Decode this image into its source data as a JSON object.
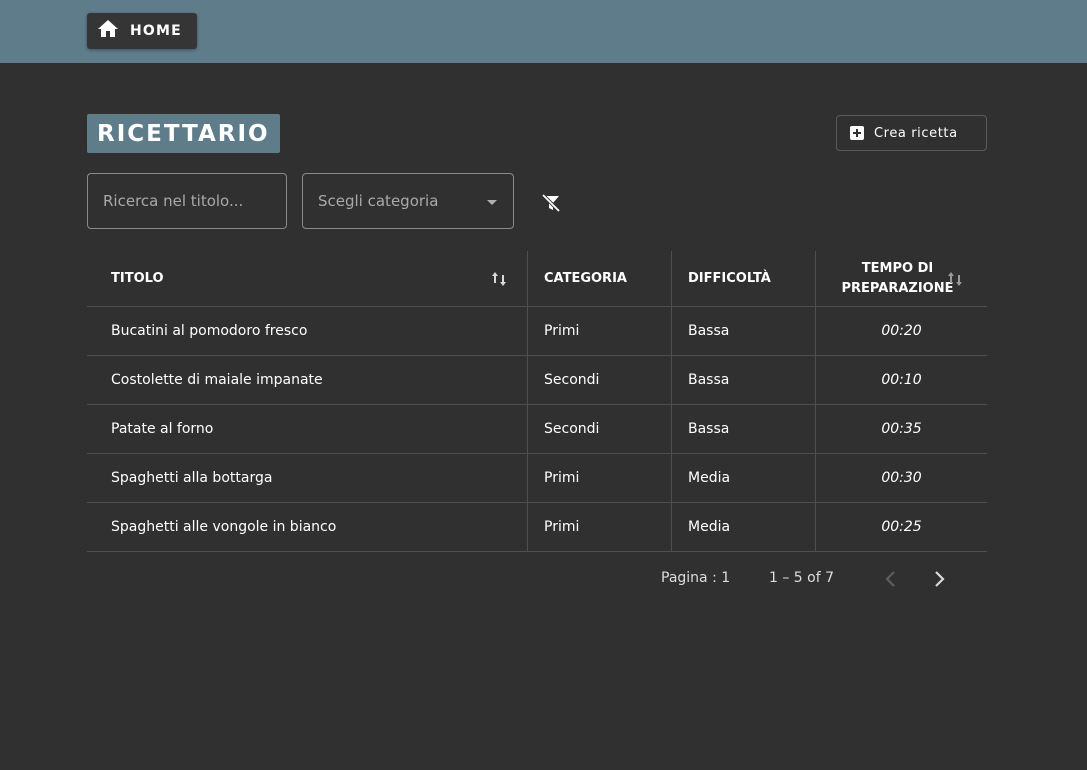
{
  "nav": {
    "home_label": "HOME"
  },
  "page": {
    "title": "RICETTARIO",
    "create_label": "Crea ricetta"
  },
  "filters": {
    "search_placeholder": "Ricerca nel titolo...",
    "category_placeholder": "Scegli categoria"
  },
  "table": {
    "headers": {
      "title": "TITOLO",
      "category": "CATEGORIA",
      "difficulty": "DIFFICOLTÀ",
      "prep_time": "TEMPO DI PREPARAZIONE"
    },
    "rows": [
      {
        "title": "Bucatini al pomodoro fresco",
        "category": "Primi",
        "difficulty": "Bassa",
        "time": "00:20"
      },
      {
        "title": "Costolette di maiale impanate",
        "category": "Secondi",
        "difficulty": "Bassa",
        "time": "00:10"
      },
      {
        "title": "Patate al forno",
        "category": "Secondi",
        "difficulty": "Bassa",
        "time": "00:35"
      },
      {
        "title": "Spaghetti alla bottarga",
        "category": "Primi",
        "difficulty": "Media",
        "time": "00:30"
      },
      {
        "title": "Spaghetti alle vongole in bianco",
        "category": "Primi",
        "difficulty": "Media",
        "time": "00:25"
      }
    ]
  },
  "pagination": {
    "page_label": "Pagina : 1",
    "range_label": "1 – 5 of 7"
  },
  "colors": {
    "header_bg": "#5f7c8b",
    "page_bg": "#303030",
    "accent": "#5f7c8b"
  }
}
